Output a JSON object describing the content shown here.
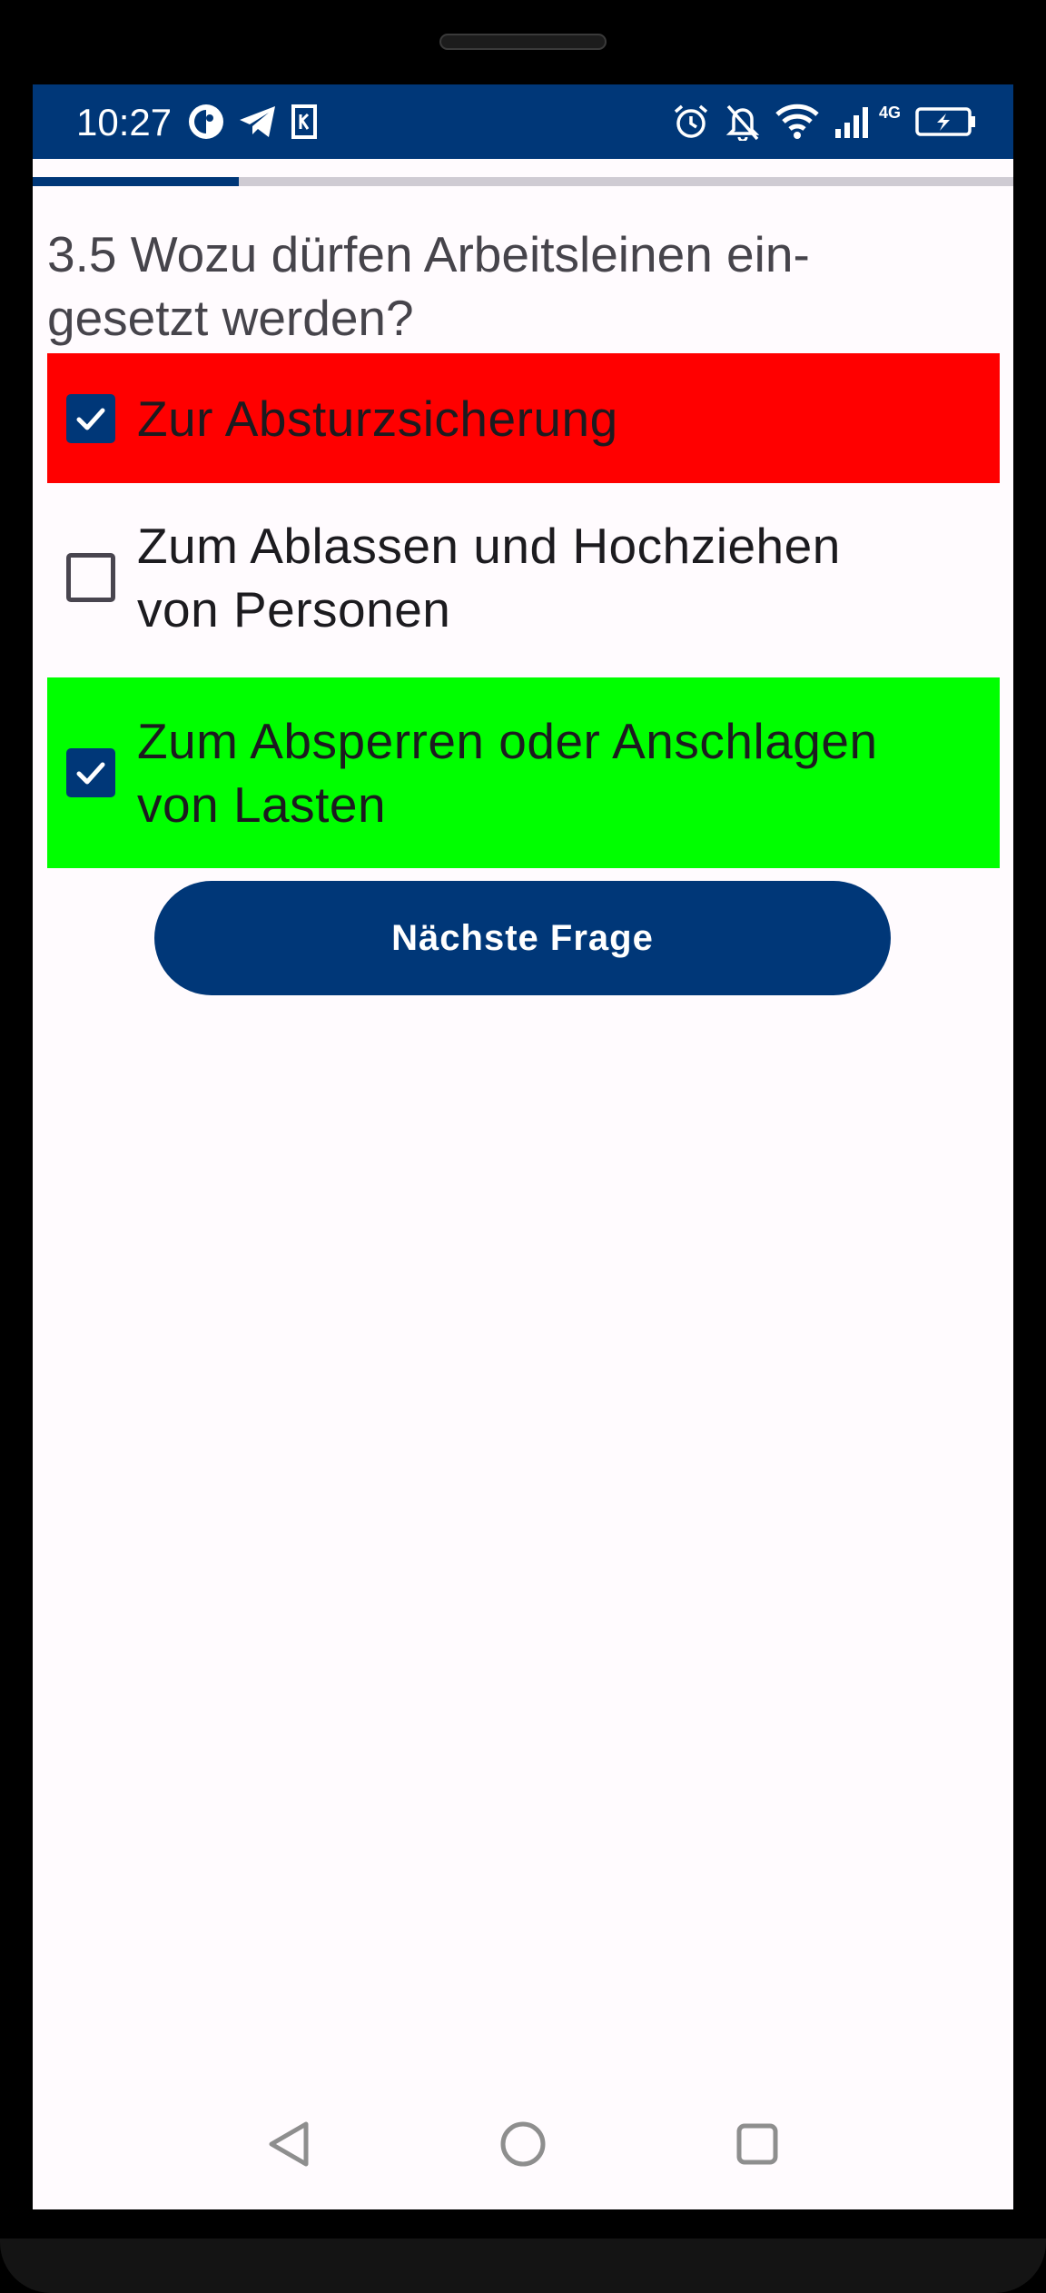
{
  "status_bar": {
    "time": "10:27",
    "network_type": "4G",
    "icons_left": [
      "app-icon",
      "telegram-icon",
      "k-app-icon"
    ],
    "icons_right": [
      "alarm-icon",
      "bell-off-icon",
      "wifi-icon",
      "signal-icon",
      "battery-charging-icon"
    ],
    "background": "#003778"
  },
  "progress": {
    "fraction": 0.21
  },
  "question": {
    "text": "3.5 Wozu dürfen Arbeitsleinen ein-\ngesetzt werden?"
  },
  "answers": [
    {
      "label": "Zur Absturzsicherung",
      "checked": true,
      "state": "wrong",
      "background": "#ff0000"
    },
    {
      "label": "Zum Ablassen und Hochziehen\nvon Personen",
      "checked": false,
      "state": "neutral",
      "background": ""
    },
    {
      "label": "Zum Absperren oder Anschlagen\nvon Lasten",
      "checked": true,
      "state": "correct",
      "background": "#00ff00"
    }
  ],
  "next_button": {
    "label": "Nächste Frage"
  },
  "nav_bar": {
    "items": [
      "back-icon",
      "home-icon",
      "recents-icon"
    ]
  },
  "colors": {
    "accent": "#003778",
    "wrong": "#ff0000",
    "correct": "#00ff00",
    "screen_background": "#fffbfe"
  }
}
